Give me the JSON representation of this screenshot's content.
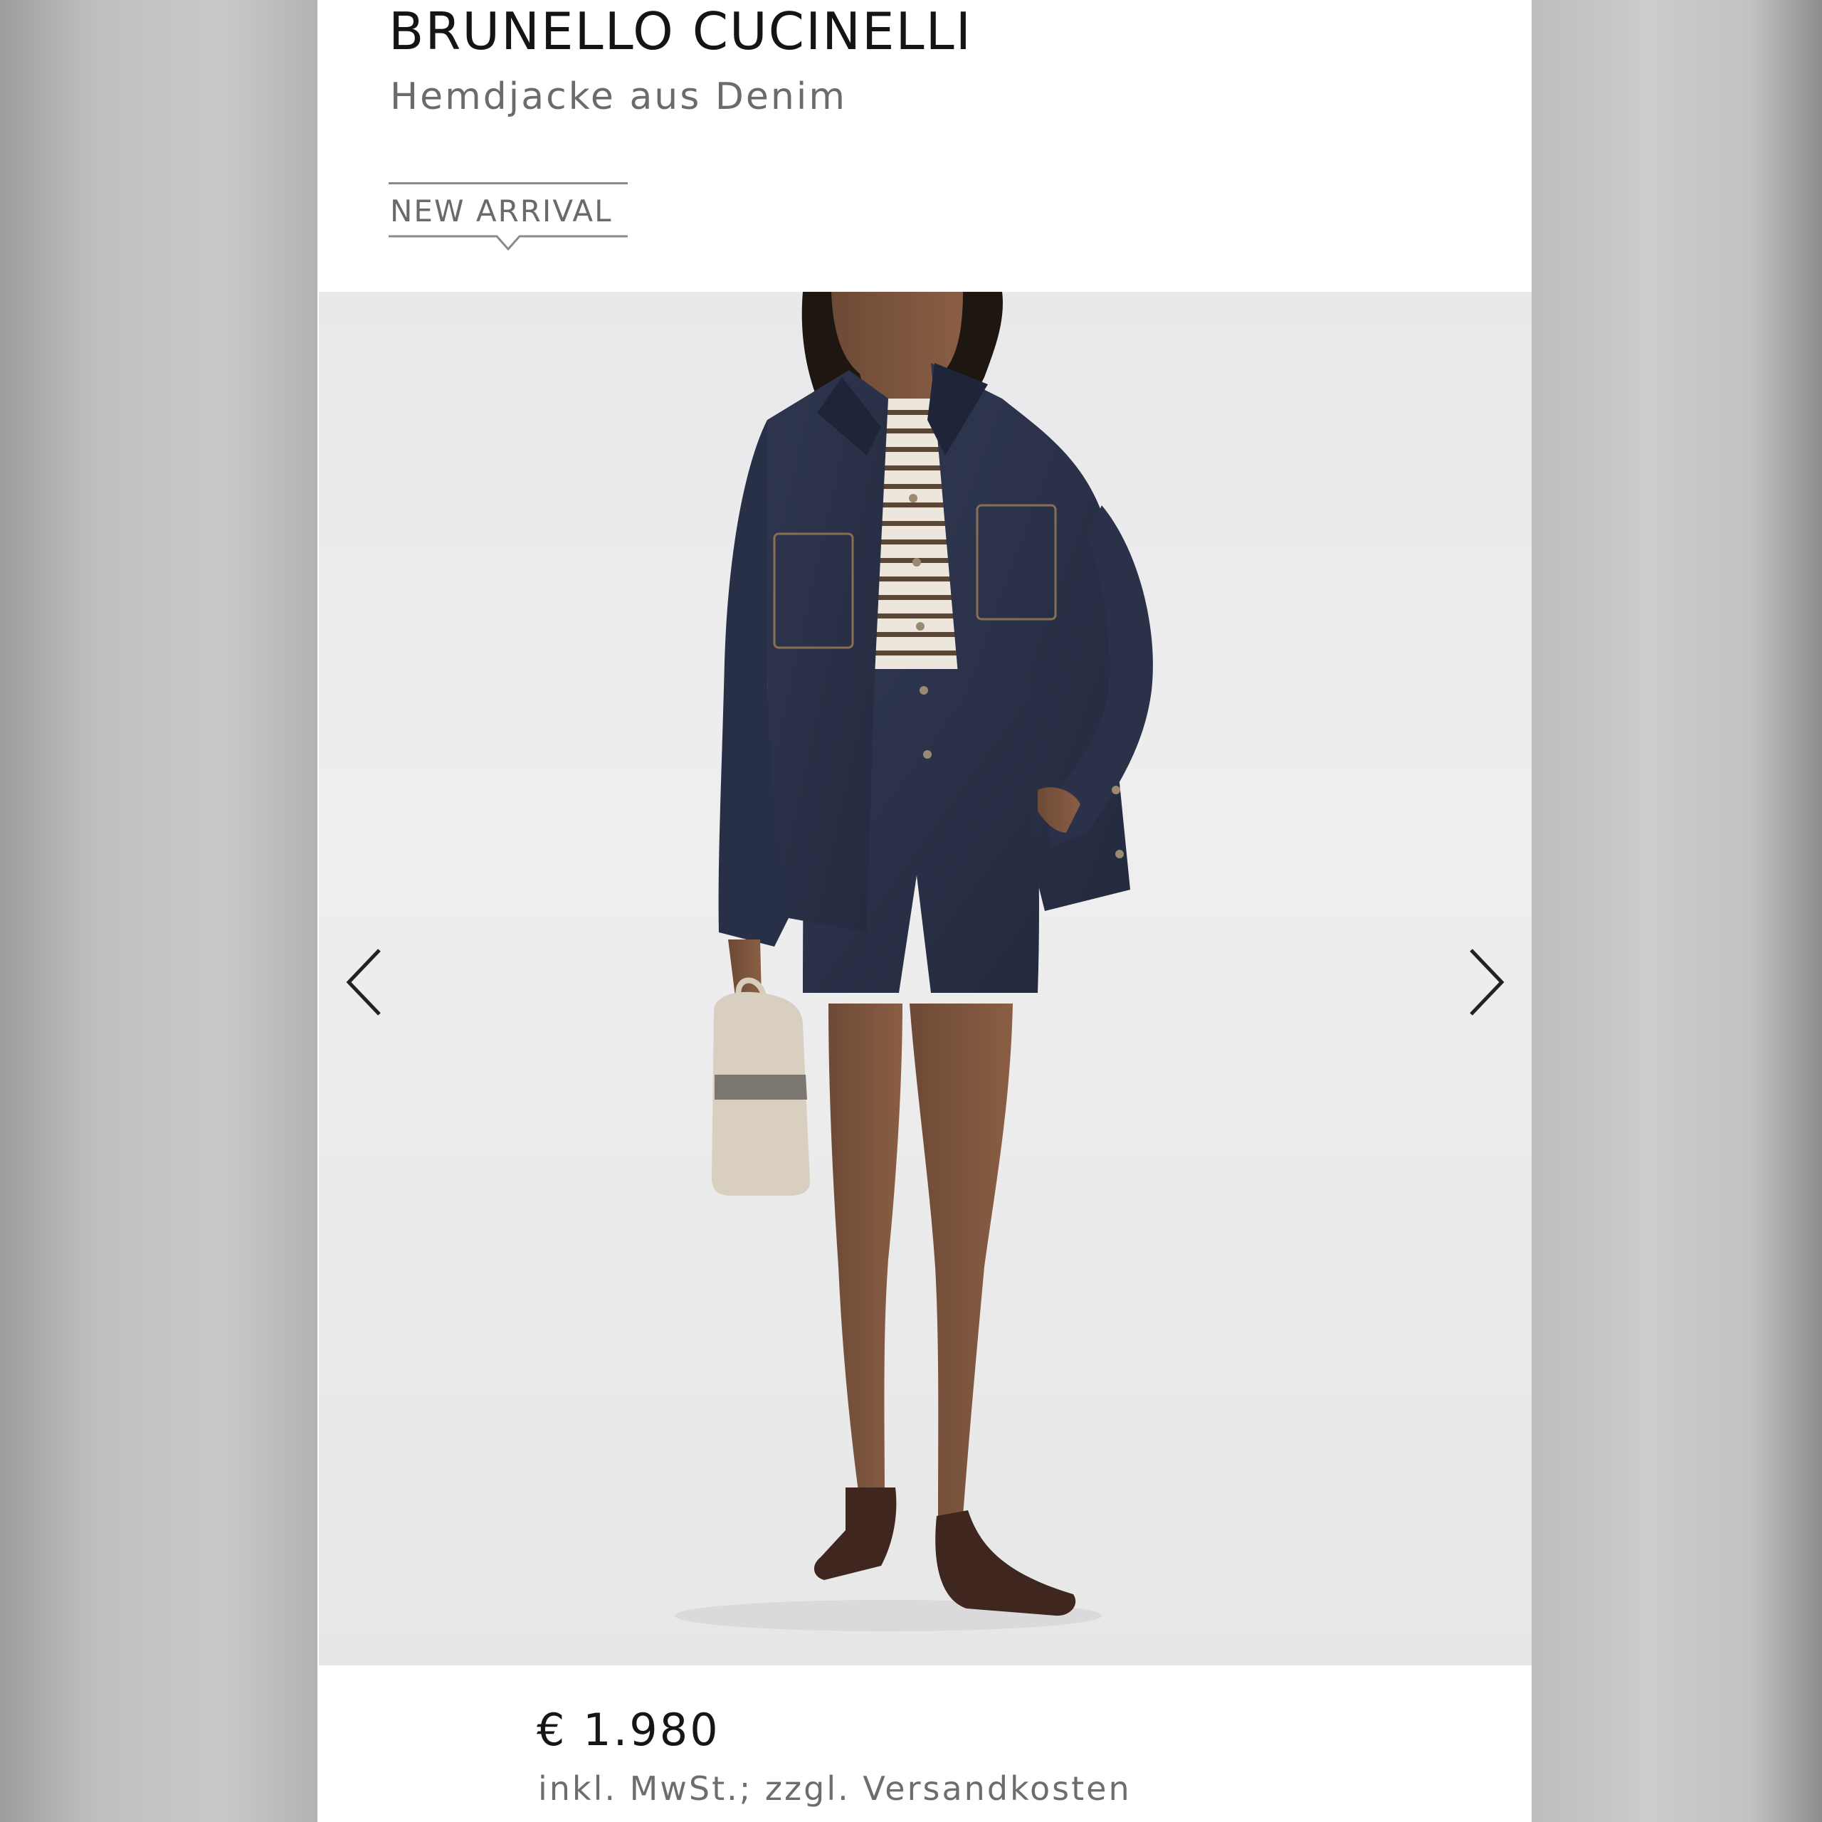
{
  "product": {
    "brand": "BRUNELLO CUCINELLI",
    "name": "Hemdjacke aus Denim",
    "badge": "NEW ARRIVAL"
  },
  "gallery": {
    "image_description_icon": "model-photo",
    "prev_icon": "chevron-left-icon",
    "next_icon": "chevron-right-icon"
  },
  "pricing": {
    "price": "€ 1.980",
    "tax_note": "inkl. MwSt.; zzgl. Versandkosten"
  },
  "colors": {
    "background_gray": "#c4c4c4",
    "card": "#ffffff",
    "photo_backdrop": "#ececed",
    "denim": "#2b3147",
    "text_dark": "#141414",
    "text_muted": "#6b6b6b"
  }
}
